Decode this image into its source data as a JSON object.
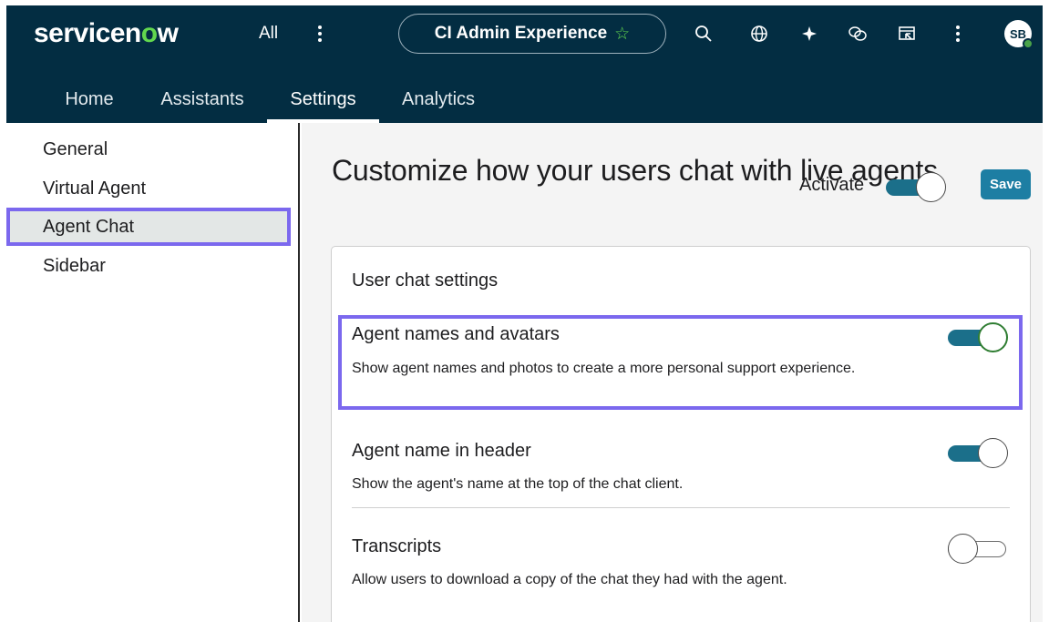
{
  "brand": {
    "text_main": "servicen",
    "text_o": "o",
    "text_end": "w"
  },
  "topbar": {
    "all_label": "All",
    "scope_label": "CI Admin Experience",
    "avatar_initials": "SB",
    "icons": [
      "search-icon",
      "globe-icon",
      "sparkle-icon",
      "chat-bubbles-icon",
      "screen-share-icon",
      "more-vertical-icon"
    ]
  },
  "tabs": [
    {
      "label": "Home"
    },
    {
      "label": "Assistants"
    },
    {
      "label": "Settings",
      "active": true
    },
    {
      "label": "Analytics"
    }
  ],
  "sidebar": {
    "items": [
      {
        "label": "General"
      },
      {
        "label": "Virtual Agent"
      },
      {
        "label": "Agent Chat",
        "selected": true
      },
      {
        "label": "Sidebar"
      }
    ]
  },
  "main": {
    "title": "Customize how your users chat with live agents",
    "activate_label": "Activate",
    "activate_on": true,
    "save_label": "Save",
    "card": {
      "title": "User chat settings",
      "settings": [
        {
          "title": "Agent names and avatars",
          "desc": "Show agent names and photos to create a more personal support experience.",
          "enabled": true
        },
        {
          "title": "Agent name in header",
          "desc": "Show the agent's name at the top of the chat client.",
          "enabled": true
        },
        {
          "title": "Transcripts",
          "desc": "Allow users to download a copy of the chat they had with the agent.",
          "enabled": false
        }
      ]
    }
  },
  "colors": {
    "header_bg": "#032d42",
    "brand_accent": "#62d84e",
    "toggle_on": "#1b6f8a",
    "save_button": "#1d7ea3",
    "highlight": "#7b68ee"
  }
}
